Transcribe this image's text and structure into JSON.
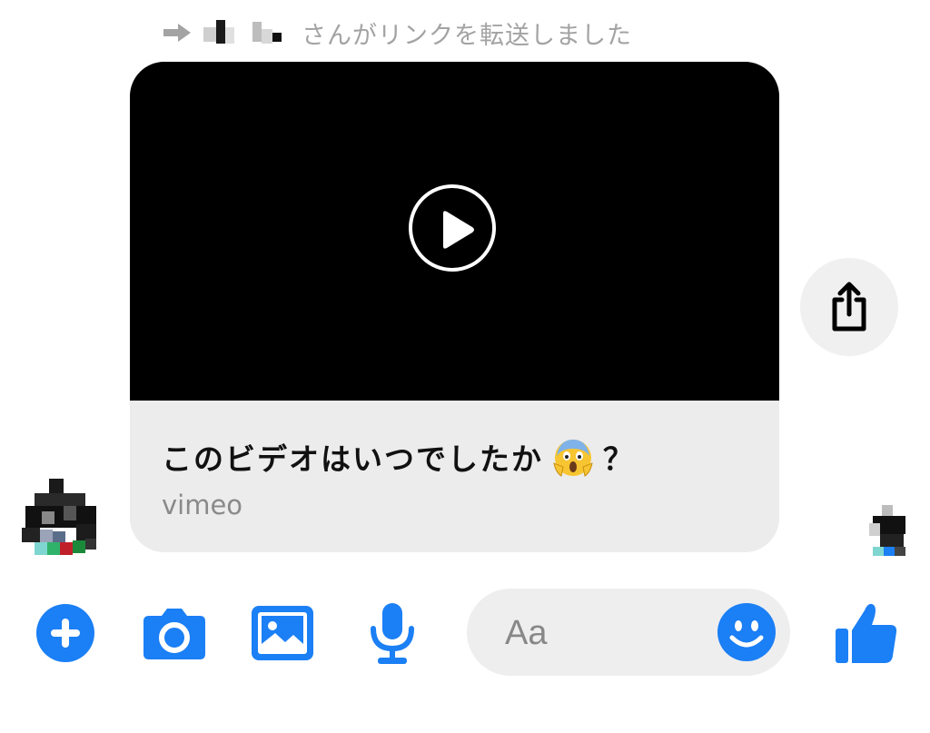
{
  "forward_header": {
    "text": "さんがリンクを転送しました",
    "color": "#a3a3a3"
  },
  "link_card": {
    "title": "このビデオはいつでしたか",
    "title_suffix": "？",
    "emoji": "face-screaming-in-fear",
    "domain": "vimeo",
    "video_background": "#000000",
    "body_background": "#ececec"
  },
  "composer": {
    "placeholder": "Aa"
  },
  "icons": {
    "add": "plus-circle-icon",
    "camera": "camera-icon",
    "gallery": "image-icon",
    "voice": "microphone-icon",
    "emoji": "smiley-icon",
    "like": "thumbs-up-icon",
    "share": "share-icon",
    "play": "play-icon"
  },
  "colors": {
    "accent": "#1b7ff5",
    "composer_bg": "#eeeeee",
    "share_bg": "#f0f0f0"
  }
}
